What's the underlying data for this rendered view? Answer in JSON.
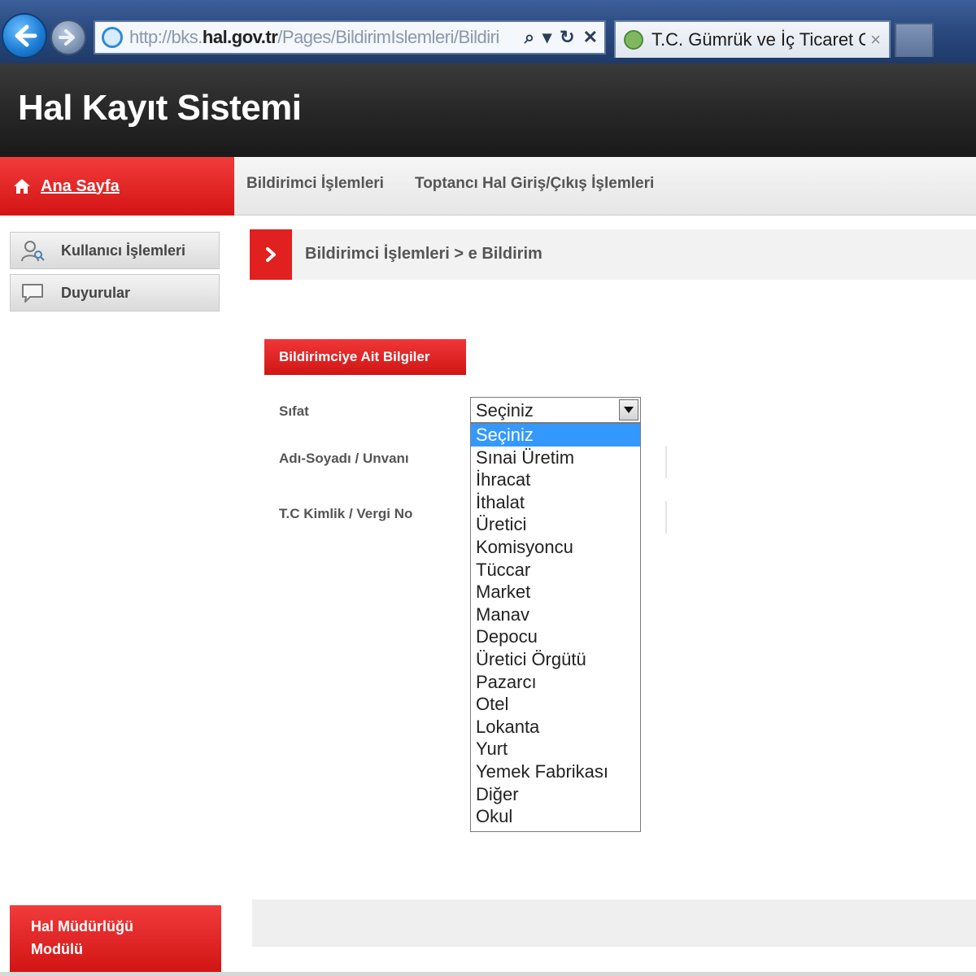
{
  "browser": {
    "url_prefix": "http://bks.",
    "url_domain": "hal.gov.tr",
    "url_path": "/Pages/BildirimIslemleri/Bildiri",
    "tab_title": "T.C. Gümrük ve İç Ticaret G...",
    "tab_close": "×",
    "search_glyph": "⌕",
    "dropdown_glyph": "▾",
    "refresh_glyph": "↻",
    "stop_glyph": "✕"
  },
  "app": {
    "title": "Hal Kayıt Sistemi"
  },
  "nav": {
    "home_label": "Ana Sayfa",
    "links": [
      "Bildirimci İşlemleri",
      "Toptancı Hal Giriş/Çıkış İşlemleri"
    ]
  },
  "sidebar": {
    "items": [
      {
        "label": "Kullanıcı İşlemleri",
        "icon": "user-magnifier-icon"
      },
      {
        "label": "Duyurular",
        "icon": "speech-bubble-icon"
      }
    ],
    "module_label_line1": "Hal Müdürlüğü",
    "module_label_line2": "Modülü"
  },
  "breadcrumb": {
    "text": "Bildirimci İşlemleri > e Bildirim"
  },
  "form": {
    "section_title": "Bildirimciye Ait Bilgiler",
    "labels": {
      "sifat": "Sıfat",
      "adsoyad": "Adı-Soyadı / Unvanı",
      "tckimlik": "T.C Kimlik / Vergi No"
    },
    "sifat_select": {
      "selected": "Seçiniz",
      "options": [
        "Seçiniz",
        "Sınai Üretim",
        "İhracat",
        "İthalat",
        "Üretici",
        "Komisyoncu",
        "Tüccar",
        "Market",
        "Manav",
        "Depocu",
        "Üretici Örgütü",
        "Pazarcı",
        "Otel",
        "Lokanta",
        "Yurt",
        "Yemek Fabrikası",
        "Diğer",
        "Okul"
      ]
    }
  },
  "colors": {
    "accent_red": "#d41414",
    "header_dark": "#262626",
    "selection_blue": "#3399ff"
  }
}
